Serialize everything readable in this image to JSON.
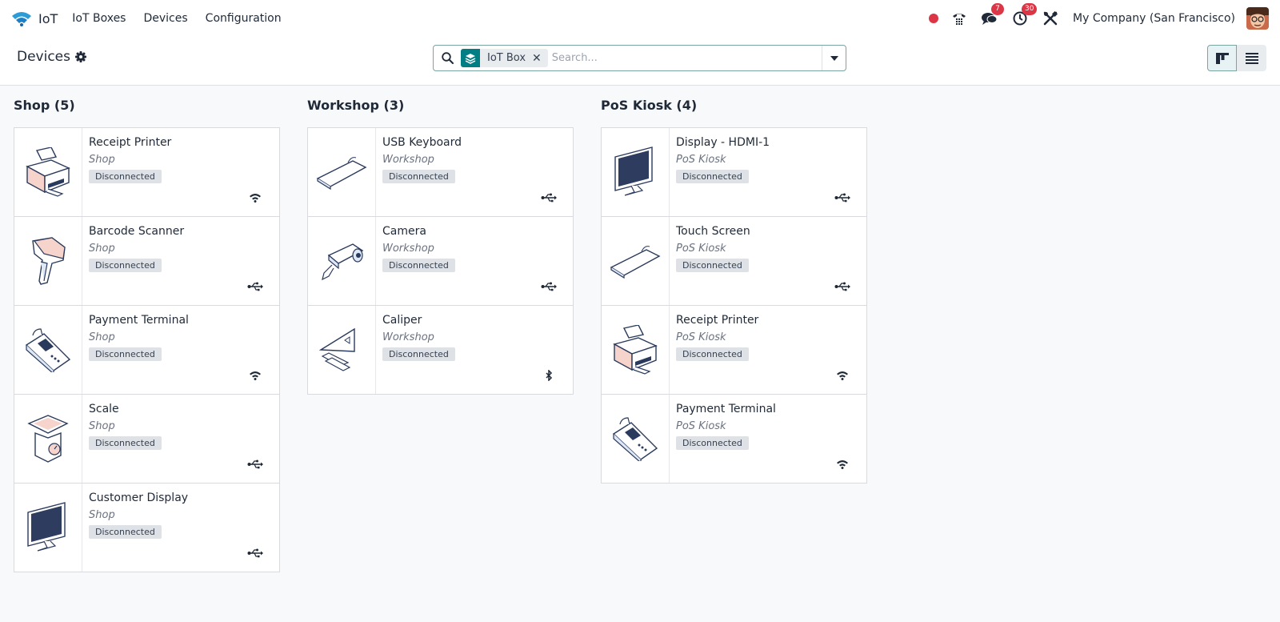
{
  "app": {
    "name": "IoT"
  },
  "menu": [
    "IoT Boxes",
    "Devices",
    "Configuration"
  ],
  "systray": {
    "messages_count": "7",
    "activities_count": "30",
    "company": "My Company (San Francisco)"
  },
  "page": {
    "title": "Devices"
  },
  "search": {
    "facet_value": "IoT Box",
    "placeholder": "Search..."
  },
  "colors": {
    "accent": "#017e84",
    "badge": "#dc3545",
    "status_bg": "#dee2e6"
  },
  "columns": [
    {
      "title": "Shop (5)",
      "devices": [
        {
          "name": "Receipt Printer",
          "location": "Shop",
          "status": "Disconnected",
          "device_icon": "printer",
          "connection_icon": "wifi"
        },
        {
          "name": "Barcode Scanner",
          "location": "Shop",
          "status": "Disconnected",
          "device_icon": "scanner",
          "connection_icon": "usb"
        },
        {
          "name": "Payment Terminal",
          "location": "Shop",
          "status": "Disconnected",
          "device_icon": "terminal",
          "connection_icon": "wifi"
        },
        {
          "name": "Scale",
          "location": "Shop",
          "status": "Disconnected",
          "device_icon": "scale",
          "connection_icon": "usb"
        },
        {
          "name": "Customer Display",
          "location": "Shop",
          "status": "Disconnected",
          "device_icon": "monitor",
          "connection_icon": "usb"
        }
      ]
    },
    {
      "title": "Workshop (3)",
      "devices": [
        {
          "name": "USB Keyboard",
          "location": "Workshop",
          "status": "Disconnected",
          "device_icon": "keyboard",
          "connection_icon": "usb"
        },
        {
          "name": "Camera",
          "location": "Workshop",
          "status": "Disconnected",
          "device_icon": "camera",
          "connection_icon": "usb"
        },
        {
          "name": "Caliper",
          "location": "Workshop",
          "status": "Disconnected",
          "device_icon": "caliper",
          "connection_icon": "bluetooth"
        }
      ]
    },
    {
      "title": "PoS Kiosk (4)",
      "devices": [
        {
          "name": "Display - HDMI-1",
          "location": "PoS Kiosk",
          "status": "Disconnected",
          "device_icon": "monitor",
          "connection_icon": "usb"
        },
        {
          "name": "Touch Screen",
          "location": "PoS Kiosk",
          "status": "Disconnected",
          "device_icon": "keyboard",
          "connection_icon": "usb"
        },
        {
          "name": "Receipt Printer",
          "location": "PoS Kiosk",
          "status": "Disconnected",
          "device_icon": "printer",
          "connection_icon": "wifi"
        },
        {
          "name": "Payment Terminal",
          "location": "PoS Kiosk",
          "status": "Disconnected",
          "device_icon": "terminal",
          "connection_icon": "wifi"
        }
      ]
    }
  ]
}
